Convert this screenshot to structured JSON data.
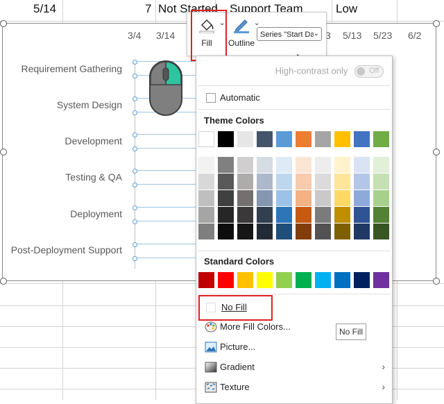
{
  "sheet_row": {
    "date": "5/14",
    "number": "7",
    "status": "Not Started",
    "owner": "Support Team",
    "priority": "Low"
  },
  "chart": {
    "x_ticks": [
      "3/4",
      "3/14",
      "3",
      "5/13",
      "5/23",
      "6/2"
    ],
    "categories": [
      "Requirement Gathering",
      "System Design",
      "Development",
      "Testing & QA",
      "Deployment",
      "Post-Deployment Support"
    ]
  },
  "toolbar": {
    "fill_label": "Fill",
    "outline_label": "Outline",
    "series_select_value": "Series \"Start Da"
  },
  "menu": {
    "high_contrast_label": "High-contrast only",
    "toggle_state": "Off",
    "automatic_label": "Automatic",
    "theme_colors_title": "Theme Colors",
    "standard_colors_title": "Standard Colors",
    "no_fill_label": "No Fill",
    "more_fill_colors_label": "More Fill Colors...",
    "picture_label": "Picture...",
    "gradient_label": "Gradient",
    "texture_label": "Texture",
    "tooltip": "No Fill"
  },
  "theme_colors": [
    "#ffffff",
    "#000000",
    "#e7e6e6",
    "#44546a",
    "#5b9bd5",
    "#ed7d31",
    "#a5a5a5",
    "#ffc000",
    "#4472c4",
    "#70ad47"
  ],
  "theme_shades": [
    [
      "#f2f2f2",
      "#808080",
      "#d0cece",
      "#d6dce4",
      "#deebf6",
      "#fbe5d5",
      "#ededed",
      "#fff2cc",
      "#dae3f3",
      "#e2efd9"
    ],
    [
      "#d8d8d8",
      "#595959",
      "#aeabab",
      "#adb9ca",
      "#bdd7ee",
      "#f7cbac",
      "#dbdbdb",
      "#fee599",
      "#b4c6e7",
      "#c5e0b3"
    ],
    [
      "#bfbfbf",
      "#404040",
      "#757070",
      "#8496b0",
      "#9cc3e5",
      "#f4b183",
      "#c9c9c9",
      "#ffd966",
      "#8eaadb",
      "#a8d08d"
    ],
    [
      "#a5a5a5",
      "#262626",
      "#3a3838",
      "#323f4f",
      "#2e75b5",
      "#c55a11",
      "#7b7b7b",
      "#bf8f00",
      "#2f5496",
      "#538135"
    ],
    [
      "#7f7f7f",
      "#0d0d0d",
      "#171616",
      "#222a35",
      "#1f4e79",
      "#833c0b",
      "#525252",
      "#7f6000",
      "#1f3864",
      "#375623"
    ]
  ],
  "standard_colors": [
    "#c00000",
    "#ff0000",
    "#ffc000",
    "#ffff00",
    "#92d050",
    "#00b050",
    "#00b0f0",
    "#0070c0",
    "#002060",
    "#7030a0"
  ],
  "colors": {
    "highlight": "#e02020",
    "series_line": "#5b9bd5",
    "mouse_body": "#7f7f7f",
    "mouse_button": "#2ec4a0"
  }
}
